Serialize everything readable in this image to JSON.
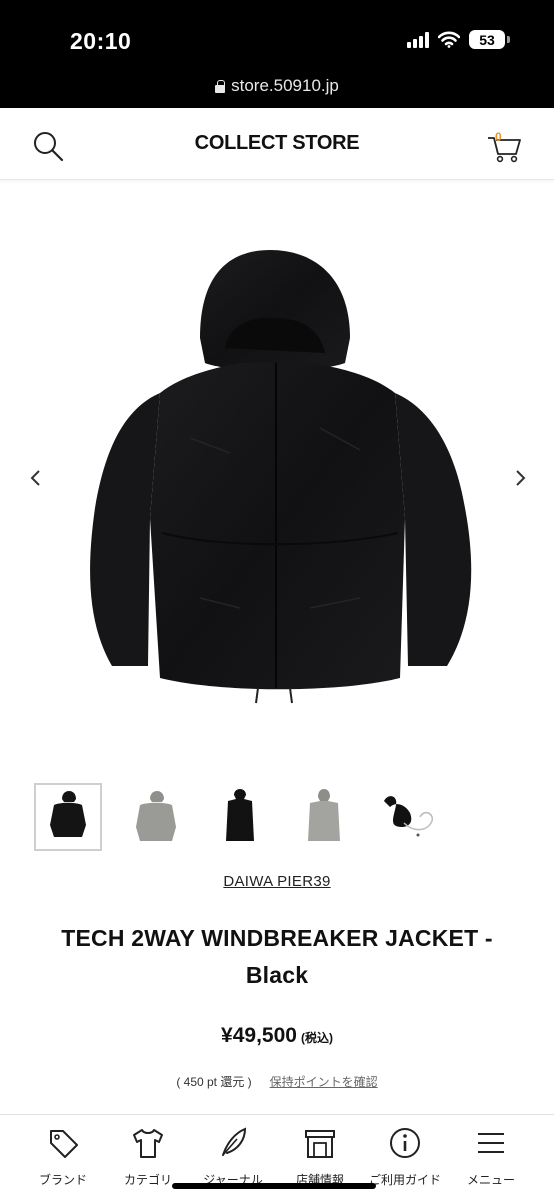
{
  "status_bar": {
    "time": "20:10",
    "battery": "53"
  },
  "browser": {
    "url": "store.50910.jp"
  },
  "header": {
    "title": "COLLECT STORE",
    "cart_count": "0"
  },
  "gallery": {
    "thumbnails": [
      "black-jacket",
      "gray-jacket",
      "black-vest",
      "gray-vest",
      "black-pouch"
    ],
    "selected_index": 0
  },
  "product": {
    "brand": "DAIWA PIER39",
    "title": "TECH 2WAY WINDBREAKER JACKET - Black",
    "price": "¥49,500",
    "tax_note": "(税込)",
    "points_text": "( 450 pt 還元 )",
    "points_link": "保持ポイントを確認"
  },
  "bottom_nav": {
    "items": [
      {
        "label": "ブランド",
        "icon": "tag-icon"
      },
      {
        "label": "カテゴリ",
        "icon": "tshirt-icon"
      },
      {
        "label": "ジャーナル",
        "icon": "feather-icon"
      },
      {
        "label": "店舗情報",
        "icon": "store-icon"
      },
      {
        "label": "ご利用ガイド",
        "icon": "info-icon"
      },
      {
        "label": "メニュー",
        "icon": "menu-icon"
      }
    ]
  },
  "colors": {
    "cart_badge": "#e8962b",
    "background": "#ffffff",
    "status_bar": "#000000"
  }
}
